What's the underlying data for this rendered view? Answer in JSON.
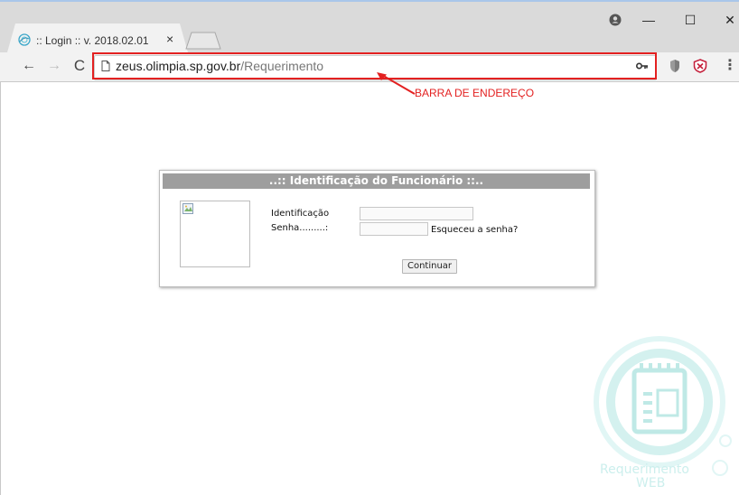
{
  "browser": {
    "tab_title": ":: Login :: v. 2018.02.01",
    "tab_close": "×",
    "url_host": "zeus.olimpia.sp.gov.br",
    "url_path": "/Requerimento",
    "window_controls": {
      "minimize": "—",
      "maximize": "☐",
      "close": "✕"
    },
    "nav": {
      "back": "←",
      "forward": "→",
      "reload": "C"
    },
    "menu": "⋮"
  },
  "annotation": {
    "label": "BARRA DE ENDEREÇO",
    "color": "#e32121"
  },
  "login": {
    "title": "..:: Identificação do Funcionário ::..",
    "identificacao_label": "Identificação",
    "identificacao_value": "",
    "senha_label": "Senha.........:",
    "senha_value": "",
    "forgot_link": "Esqueceu a senha?",
    "submit_label": "Continuar"
  },
  "watermark": {
    "line1": "Requerimento",
    "line2": "WEB",
    "color": "#ccefed"
  },
  "colors": {
    "header_bg": "#9e9e9e",
    "chrome_bg": "#dadada",
    "toolbar_bg": "#f2f2f2"
  }
}
